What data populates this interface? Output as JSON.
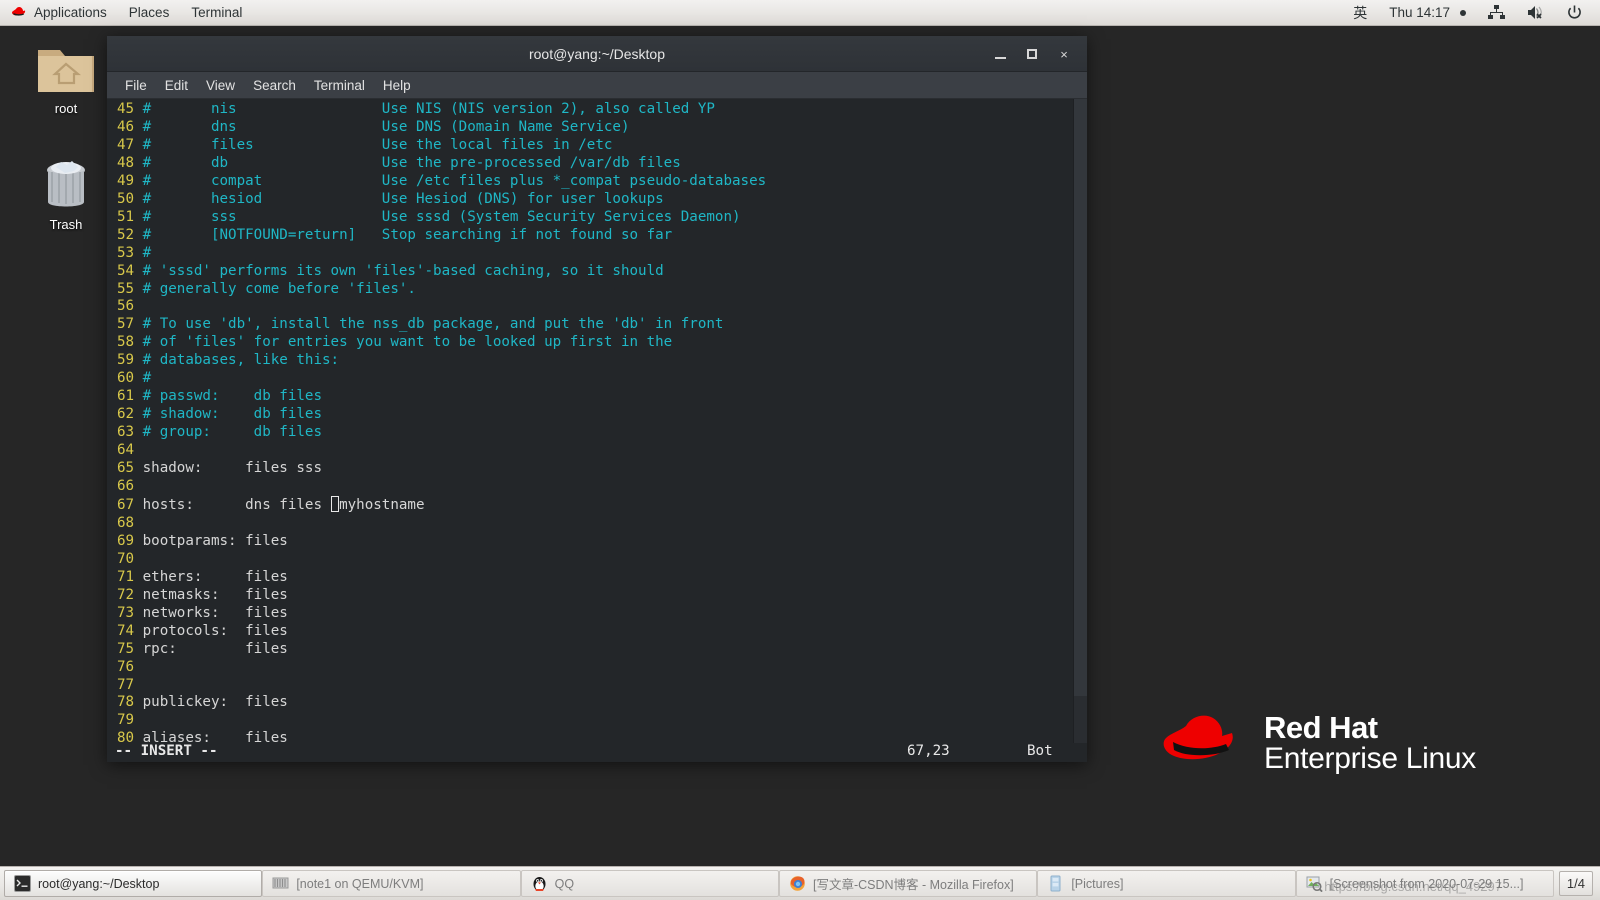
{
  "top_panel": {
    "logo_icon": "redhat-hat-icon",
    "menus": [
      {
        "label": "Applications"
      },
      {
        "label": "Places"
      },
      {
        "label": "Terminal"
      }
    ],
    "input_method": "英",
    "clock": "Thu 14:17",
    "tray": [
      {
        "name": "network-icon"
      },
      {
        "name": "volume-muted-icon"
      },
      {
        "name": "power-icon"
      }
    ]
  },
  "desktop": {
    "icons": [
      {
        "label": "root",
        "icon": "home-folder-icon"
      },
      {
        "label": "Trash",
        "icon": "trash-icon"
      }
    ],
    "branding": {
      "line1": "Red Hat",
      "line2": "Enterprise Linux",
      "logo_icon": "redhat-hat-icon"
    }
  },
  "terminal": {
    "title": "root@yang:~/Desktop",
    "window_buttons": {
      "minimize": "minimize-icon",
      "maximize": "maximize-icon",
      "close": "×"
    },
    "menubar": [
      {
        "label": "File"
      },
      {
        "label": "Edit"
      },
      {
        "label": "View"
      },
      {
        "label": "Search"
      },
      {
        "label": "Terminal"
      },
      {
        "label": "Help"
      }
    ],
    "lines": [
      {
        "n": "45",
        "text": "#       nis                 Use NIS (NIS version 2), also called YP",
        "kind": "comment"
      },
      {
        "n": "46",
        "text": "#       dns                 Use DNS (Domain Name Service)",
        "kind": "comment"
      },
      {
        "n": "47",
        "text": "#       files               Use the local files in /etc",
        "kind": "comment"
      },
      {
        "n": "48",
        "text": "#       db                  Use the pre-processed /var/db files",
        "kind": "comment"
      },
      {
        "n": "49",
        "text": "#       compat              Use /etc files plus *_compat pseudo-databases",
        "kind": "comment"
      },
      {
        "n": "50",
        "text": "#       hesiod              Use Hesiod (DNS) for user lookups",
        "kind": "comment"
      },
      {
        "n": "51",
        "text": "#       sss                 Use sssd (System Security Services Daemon)",
        "kind": "comment"
      },
      {
        "n": "52",
        "text": "#       [NOTFOUND=return]   Stop searching if not found so far",
        "kind": "comment"
      },
      {
        "n": "53",
        "text": "#",
        "kind": "comment"
      },
      {
        "n": "54",
        "text": "# 'sssd' performs its own 'files'-based caching, so it should",
        "kind": "comment"
      },
      {
        "n": "55",
        "text": "# generally come before 'files'.",
        "kind": "comment"
      },
      {
        "n": "56",
        "text": "",
        "kind": "comment"
      },
      {
        "n": "57",
        "text": "# To use 'db', install the nss_db package, and put the 'db' in front",
        "kind": "comment"
      },
      {
        "n": "58",
        "text": "# of 'files' for entries you want to be looked up first in the",
        "kind": "comment"
      },
      {
        "n": "59",
        "text": "# databases, like this:",
        "kind": "comment"
      },
      {
        "n": "60",
        "text": "#",
        "kind": "comment"
      },
      {
        "n": "61",
        "text": "# passwd:    db files",
        "kind": "comment"
      },
      {
        "n": "62",
        "text": "# shadow:    db files",
        "kind": "comment"
      },
      {
        "n": "63",
        "text": "# group:     db files",
        "kind": "comment"
      },
      {
        "n": "64",
        "text": "",
        "kind": "plain"
      },
      {
        "n": "65",
        "text": "shadow:     files sss",
        "kind": "plain"
      },
      {
        "n": "66",
        "text": "",
        "kind": "plain"
      },
      {
        "n": "67",
        "text": "hosts:      dns files ",
        "text_after_cursor": "myhostname",
        "kind": "plain",
        "cursor": true
      },
      {
        "n": "68",
        "text": "",
        "kind": "plain"
      },
      {
        "n": "69",
        "text": "bootparams: files",
        "kind": "plain"
      },
      {
        "n": "70",
        "text": "",
        "kind": "plain"
      },
      {
        "n": "71",
        "text": "ethers:     files",
        "kind": "plain"
      },
      {
        "n": "72",
        "text": "netmasks:   files",
        "kind": "plain"
      },
      {
        "n": "73",
        "text": "networks:   files",
        "kind": "plain"
      },
      {
        "n": "74",
        "text": "protocols:  files",
        "kind": "plain"
      },
      {
        "n": "75",
        "text": "rpc:        files",
        "kind": "plain"
      },
      {
        "n": "76",
        "text": "",
        "kind": "plain"
      },
      {
        "n": "77",
        "text": "",
        "kind": "plain"
      },
      {
        "n": "78",
        "text": "publickey:  files",
        "kind": "plain"
      },
      {
        "n": "79",
        "text": "",
        "kind": "plain"
      },
      {
        "n": "80",
        "text": "aliases:    files",
        "kind": "plain"
      }
    ],
    "status": {
      "mode": "-- INSERT --",
      "position": "67,23",
      "scroll": "Bot"
    }
  },
  "taskbar": {
    "items": [
      {
        "label": "root@yang:~/Desktop",
        "icon": "terminal-icon",
        "state": "active"
      },
      {
        "label": "[note1 on QEMU/KVM]",
        "icon": "virtmanager-icon",
        "state": "inactive"
      },
      {
        "label": "QQ",
        "icon": "qq-penguin-icon",
        "state": "inactive"
      },
      {
        "label": "[写文章-CSDN博客 - Mozilla Firefox]",
        "icon": "firefox-icon",
        "state": "inactive"
      },
      {
        "label": "[Pictures]",
        "icon": "file-manager-icon",
        "state": "inactive"
      },
      {
        "label": "[Screenshot from 2020-07-29 15...]",
        "icon": "image-viewer-icon",
        "state": "inactive"
      }
    ],
    "pager": "1/4",
    "watermark": "https://blog.csdn.net/qq_49297"
  },
  "colors": {
    "panel_bg": "#e8e6e3",
    "terminal_bg": "#232629",
    "line_number": "#d8c84a",
    "comment": "#1fb7c6",
    "plain_text": "#d6d6d6",
    "redhat_red": "#ee0000",
    "desktop_bg": "#262626"
  }
}
